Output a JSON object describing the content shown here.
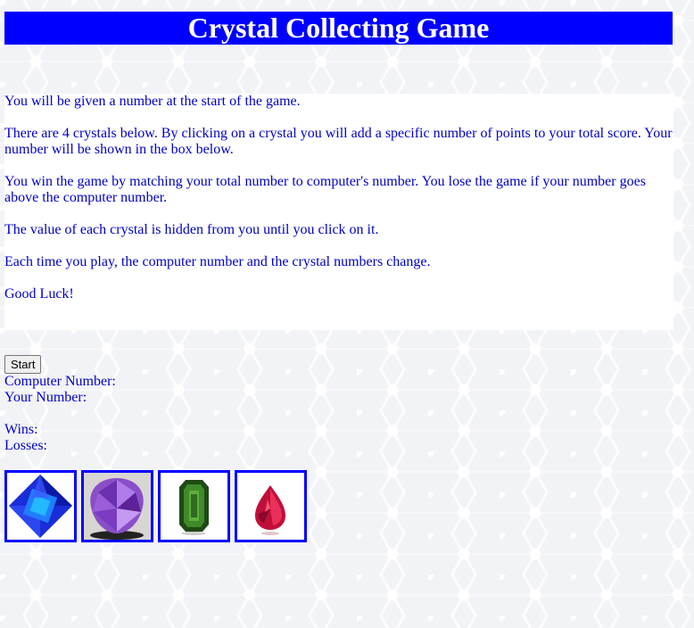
{
  "header": {
    "title": "Crystal Collecting Game"
  },
  "instructions": {
    "paragraphs": [
      "You will be given a number at the start of the game.",
      "There are 4 crystals below. By clicking on a crystal you will add a specific number of points to your total score. Your number will be shown in the box below.",
      "You win the game by matching your total number to computer's number. You lose the game if your number goes above the computer number.",
      "The value of each crystal is hidden from you until you click on it.",
      "Each time you play, the computer number and the crystal numbers change.",
      "Good Luck!"
    ]
  },
  "controls": {
    "start_label": "Start",
    "computer_number_label": "Computer Number:",
    "your_number_label": "Your Number:",
    "wins_label": "Wins:",
    "losses_label": "Losses:"
  },
  "crystals": [
    {
      "name": "blue-crystal",
      "color": "#1e3cff"
    },
    {
      "name": "purple-crystal",
      "color": "#8a4fc8"
    },
    {
      "name": "green-crystal",
      "color": "#2f6b22"
    },
    {
      "name": "red-crystal",
      "color": "#c0103a"
    }
  ],
  "colors": {
    "accent": "#0000ff",
    "text": "#0000c8"
  }
}
